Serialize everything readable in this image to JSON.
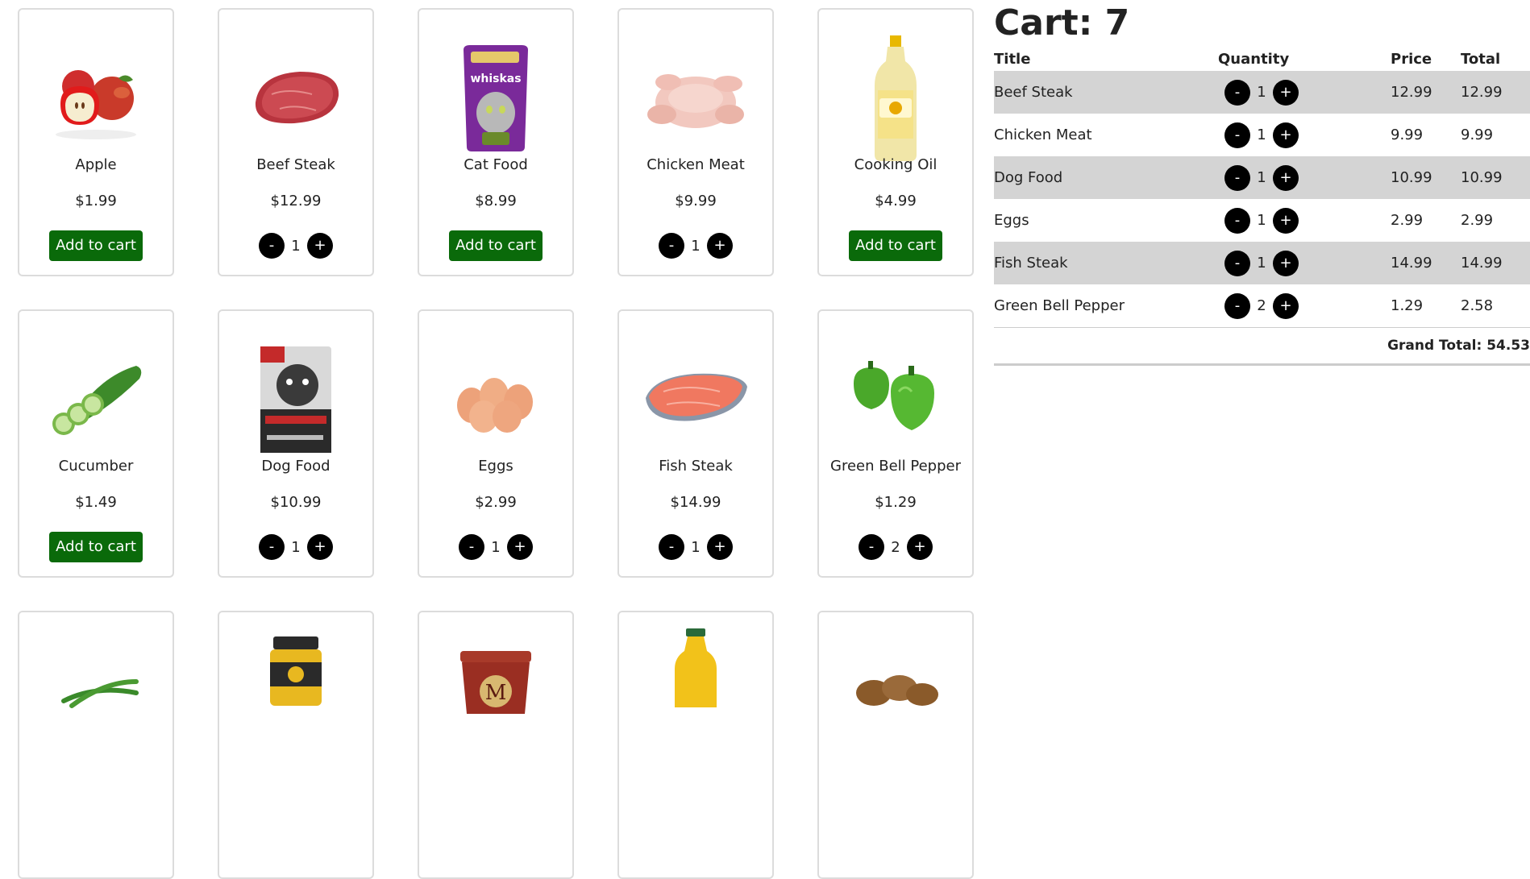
{
  "products": [
    {
      "name": "Apple",
      "price": "$1.99",
      "action": "add",
      "add_label": "Add to cart",
      "icon": "apple-icon"
    },
    {
      "name": "Beef Steak",
      "price": "$12.99",
      "action": "qty",
      "qty": "1",
      "icon": "beef-steak-icon"
    },
    {
      "name": "Cat Food",
      "price": "$8.99",
      "action": "add",
      "add_label": "Add to cart",
      "icon": "cat-food-icon",
      "brand": "whiskas"
    },
    {
      "name": "Chicken Meat",
      "price": "$9.99",
      "action": "qty",
      "qty": "1",
      "icon": "chicken-icon"
    },
    {
      "name": "Cooking Oil",
      "price": "$4.99",
      "action": "add",
      "add_label": "Add to cart",
      "icon": "oil-bottle-icon"
    },
    {
      "name": "Cucumber",
      "price": "$1.49",
      "action": "add",
      "add_label": "Add to cart",
      "icon": "cucumber-icon"
    },
    {
      "name": "Dog Food",
      "price": "$10.99",
      "action": "qty",
      "qty": "1",
      "icon": "dog-food-icon"
    },
    {
      "name": "Eggs",
      "price": "$2.99",
      "action": "qty",
      "qty": "1",
      "icon": "eggs-icon"
    },
    {
      "name": "Fish Steak",
      "price": "$14.99",
      "action": "qty",
      "qty": "1",
      "icon": "fish-steak-icon"
    },
    {
      "name": "Green Bell Pepper",
      "price": "$1.29",
      "action": "qty",
      "qty": "2",
      "icon": "bell-pepper-icon"
    },
    {
      "icon": "green-beans-icon"
    },
    {
      "icon": "honey-jar-icon"
    },
    {
      "icon": "ice-cream-tub-icon"
    },
    {
      "icon": "juice-bottle-icon"
    },
    {
      "icon": "potato-icon"
    }
  ],
  "buttons": {
    "minus": "-",
    "plus": "+"
  },
  "cart": {
    "heading": "Cart: 7",
    "headers": {
      "title": "Title",
      "quantity": "Quantity",
      "price": "Price",
      "total": "Total"
    },
    "rows": [
      {
        "title": "Beef Steak",
        "qty": "1",
        "price": "12.99",
        "total": "12.99"
      },
      {
        "title": "Chicken Meat",
        "qty": "1",
        "price": "9.99",
        "total": "9.99"
      },
      {
        "title": "Dog Food",
        "qty": "1",
        "price": "10.99",
        "total": "10.99"
      },
      {
        "title": "Eggs",
        "qty": "1",
        "price": "2.99",
        "total": "2.99"
      },
      {
        "title": "Fish Steak",
        "qty": "1",
        "price": "14.99",
        "total": "14.99"
      },
      {
        "title": "Green Bell Pepper",
        "qty": "2",
        "price": "1.29",
        "total": "2.58"
      }
    ],
    "grand_total": "Grand Total: 54.53"
  },
  "colors": {
    "add_button": "#0a6a0a",
    "row_stripe": "#d4d4d4",
    "round_button": "#000000"
  }
}
